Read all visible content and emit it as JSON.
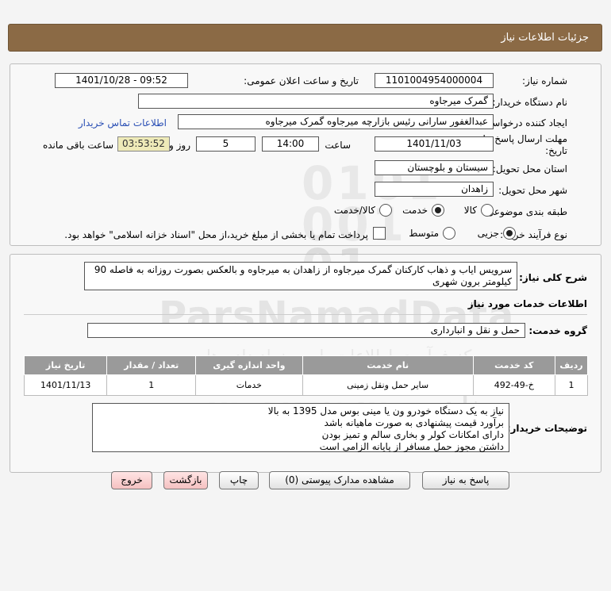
{
  "header": {
    "title": "جزئیات اطلاعات نیاز"
  },
  "need_info": {
    "need_number_label": "شماره نیاز:",
    "need_number": "1101004954000004",
    "announce_label": "تاریخ و ساعت اعلان عمومی:",
    "announce_value": "1401/10/28 - 09:52",
    "buyer_org_label": "نام دستگاه خریدار:",
    "buyer_org": "گمرک میرجاوه",
    "creator_label": "ایجاد کننده درخواست:",
    "creator": "عبدالغفور سارانی رئیس بازارچه میرجاوه گمرک میرجاوه",
    "contact_link": "اطلاعات تماس خریدار",
    "deadline_label_1": "مهلت ارسال پاسخ: تا",
    "deadline_label_2": "تاریخ:",
    "deadline_date": "1401/11/03",
    "time_label": "ساعت",
    "deadline_time": "14:00",
    "days_value": "5",
    "days_label": "روز و",
    "remaining_time": "03:53:52",
    "remaining_label": "ساعت باقی مانده",
    "province_label": "استان محل تحویل:",
    "province": "سیستان و بلوچستان",
    "city_label": "شهر محل تحویل:",
    "city": "زاهدان",
    "category_label": "طبقه بندی موضوعی:",
    "category_options": [
      "کالا",
      "خدمت",
      "کالا/خدمت"
    ],
    "category_selected": "خدمت",
    "process_label": "نوع فرآیند خرید :",
    "process_options": [
      "جزیی",
      "متوسط"
    ],
    "process_selected": "جزیی",
    "treasury_note": "پرداخت تمام یا بخشی از مبلغ خرید،از محل \"اسناد خزانه اسلامی\" خواهد بود."
  },
  "details": {
    "summary_label": "شرح کلی نیاز:",
    "summary": "سرویس ایاب و ذهاب کارکنان گمرک میرجاوه از زاهدان به میرجاوه و بالعکس بصورت روزانه به فاصله 90 کیلومتر برون شهری",
    "services_title": "اطلاعات خدمات مورد نیاز",
    "service_group_label": "گروه خدمت:",
    "service_group": "حمل و نقل و انبارداری",
    "table": {
      "headers": [
        "ردیف",
        "کد خدمت",
        "نام خدمت",
        "واحد اندازه گیری",
        "تعداد / مقدار",
        "تاریخ نیاز"
      ],
      "rows": [
        [
          "1",
          "خ-49-492",
          "سایر حمل ونقل زمینی",
          "خدمات",
          "1",
          "1401/11/13"
        ]
      ]
    },
    "buyer_notes_label": "توضیحات خریدار:",
    "buyer_notes": [
      "نیاز به یک دستگاه خودرو ون یا مینی بوس مدل 1395 به بالا",
      "برآورد قیمت پیشنهادی به صورت ماهیانه باشد",
      "دارای امکانات کولر و بخاری سالم و تمیز بودن",
      "داشتن مجوز حمل مسافر از پایانه الزامی است"
    ]
  },
  "buttons": {
    "respond": "پاسخ به نیاز",
    "attachments": "مشاهده مدارک پیوستی (0)",
    "print": "چاپ",
    "back": "بازگشت",
    "exit": "خروج"
  },
  "watermark": {
    "brand": "ParsNamadData",
    "line1": "مرکز فرآوری اطلاعات پارس نماد داده ها",
    "line2": "پایگاه اطلاع رسانی مناقصه و مزایده",
    "phone": "۰۲۱-۸۸۳۴۹۶۷۰"
  },
  "colors": {
    "header": "#8b6a45",
    "table_header": "#9a9a9a",
    "link": "#2a4fb5",
    "remaining_bg": "#eeeab8"
  }
}
